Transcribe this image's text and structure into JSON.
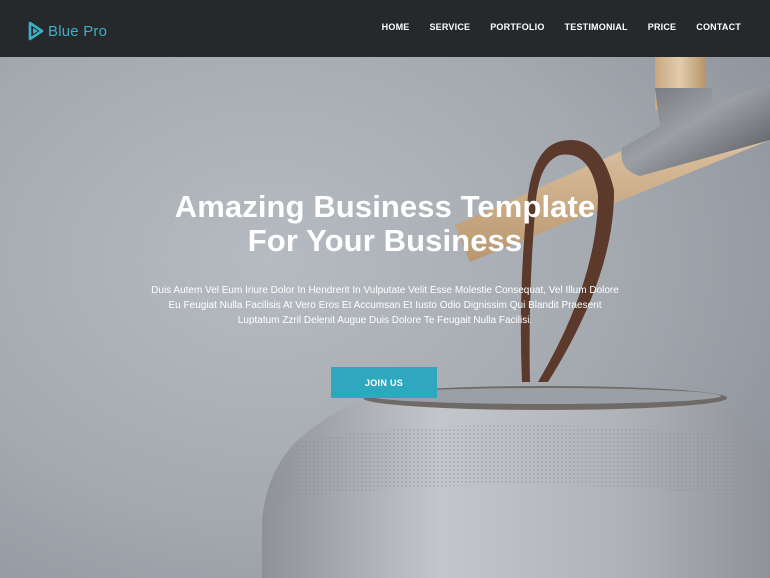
{
  "brand": {
    "name": "Blue Pro",
    "icon": "play-logo-icon",
    "color": "#3ab0c8"
  },
  "nav": {
    "items": [
      "HOME",
      "SERVICE",
      "PORTFOLIO",
      "TESTIMONIAL",
      "PRICE",
      "CONTACT"
    ]
  },
  "hero": {
    "title_line1": "Amazing Business Template",
    "title_line2": "For Your Business",
    "description": "Duis Autem Vel Eum Iriure Dolor In Hendrerit In Vulputate Velit Esse Molestie Consequat, Vel Illum Dolore Eu Feugiat Nulla Facilisis At Vero Eros Et Accumsan Et Iusto Odio Dignissim Qui Blandit Praesent Luptatum Zzril Delenit Augue Duis Dolore Te Feugait Nulla Facilisi.",
    "button_label": "JOIN US",
    "button_color": "#2fa7bf"
  },
  "colors": {
    "navbar": "#26292c",
    "background": "#a7acb3"
  }
}
